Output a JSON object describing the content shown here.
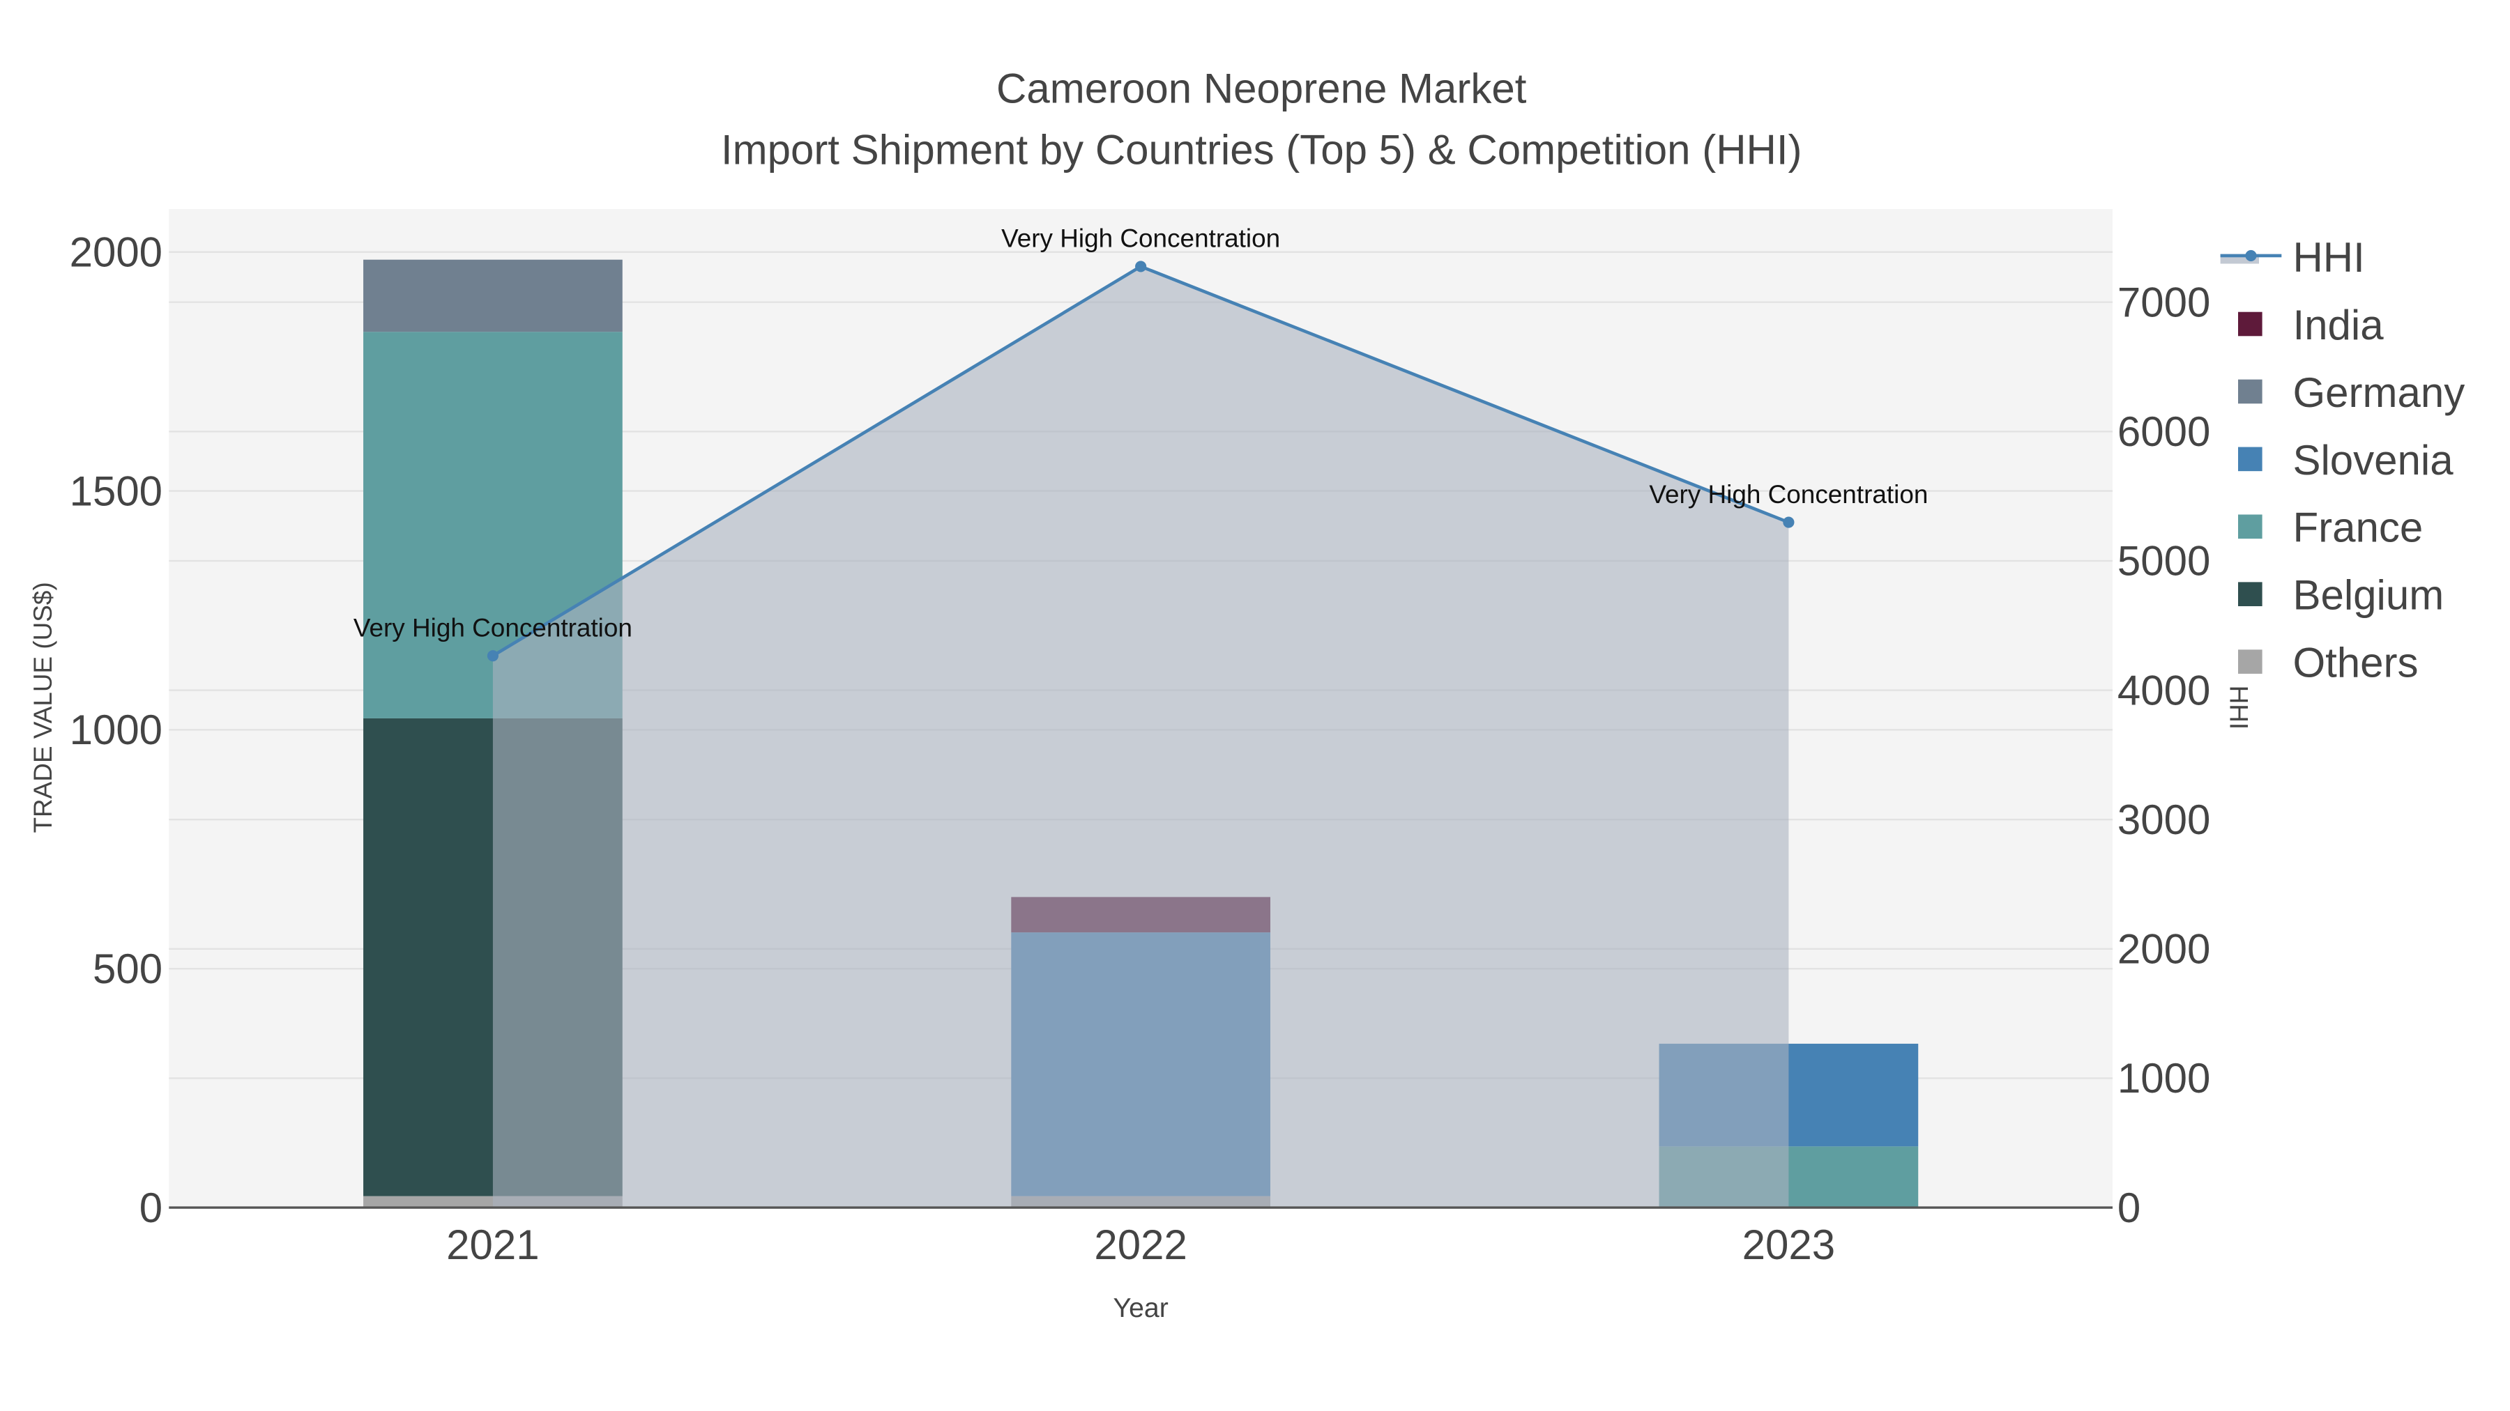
{
  "chart_data": {
    "type": "bar",
    "title": "Cameroon Neoprene Market",
    "subtitle": "Import Shipment by Countries (Top 5) & Competition (HHI)",
    "xlabel": "Year",
    "ylabel": "TRADE VALUE (US$)",
    "y2label": "HHI",
    "categories": [
      "2021",
      "2022",
      "2023"
    ],
    "ylim": [
      0,
      2090
    ],
    "y2lim": [
      0,
      7720
    ],
    "yticks": [
      0,
      500,
      1000,
      1500,
      2000
    ],
    "y2ticks": [
      0,
      1000,
      2000,
      3000,
      4000,
      5000,
      6000,
      7000
    ],
    "stacked": true,
    "series": [
      {
        "name": "Others",
        "color": "#a6a6a6",
        "values": [
          24,
          24,
          0
        ]
      },
      {
        "name": "Belgium",
        "color": "#2f4f4f",
        "values": [
          1000,
          0,
          0
        ]
      },
      {
        "name": "France",
        "color": "#5f9ea0",
        "values": [
          809,
          0,
          128
        ]
      },
      {
        "name": "Slovenia",
        "color": "#4682b4",
        "values": [
          0,
          552,
          215
        ]
      },
      {
        "name": "Germany",
        "color": "#708090",
        "values": [
          151,
          0,
          0
        ]
      },
      {
        "name": "India",
        "color": "#5e1a3a",
        "values": [
          0,
          74,
          0
        ]
      }
    ],
    "hhi": {
      "name": "HHI",
      "color": "#4682b4",
      "values": [
        4266,
        7276,
        5298
      ]
    },
    "annotations": [
      "Very High Concentration",
      "Very High Concentration",
      "Very High Concentration"
    ],
    "legend_order": [
      "HHI",
      "India",
      "Germany",
      "Slovenia",
      "France",
      "Belgium",
      "Others"
    ],
    "legend_position": "right"
  }
}
